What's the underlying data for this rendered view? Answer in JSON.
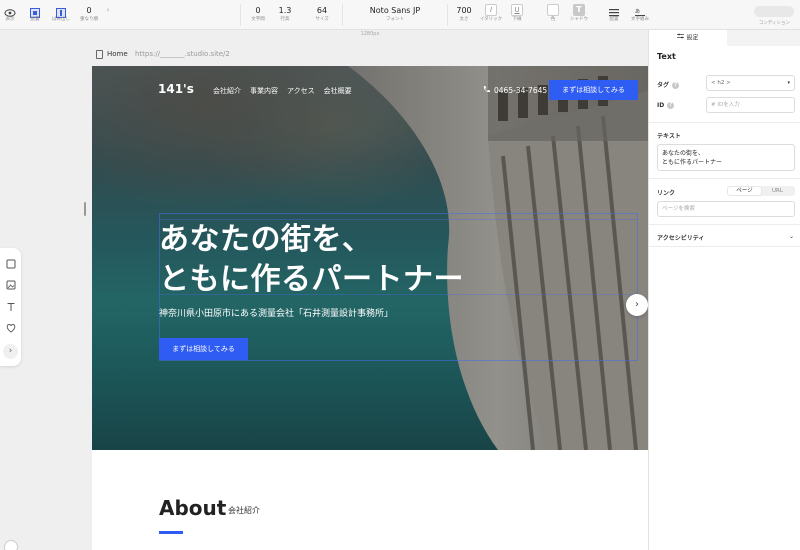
{
  "toolbar": {
    "left_tools": [
      {
        "label": "表示",
        "icon": "eye-icon"
      },
      {
        "label": "配置",
        "icon": "layout-icon"
      },
      {
        "label": "はみ出し",
        "icon": "overflow-icon"
      },
      {
        "label": "重なり順",
        "value": "0"
      }
    ],
    "text_tools": {
      "letter_spacing": {
        "label": "文字間",
        "value": "0"
      },
      "line_height": {
        "label": "行高",
        "value": "1.3"
      },
      "size": {
        "label": "サイズ",
        "value": "64"
      },
      "font": {
        "label": "フォント",
        "value": "Noto Sans JP"
      },
      "weight": {
        "label": "太さ",
        "value": "700"
      },
      "italic": {
        "label": "イタリック",
        "icon": "italic-icon"
      },
      "underline": {
        "label": "下線",
        "icon": "underline-icon"
      },
      "color": {
        "label": "色"
      },
      "shadow": {
        "label": "シャドウ",
        "icon": "text-shadow-icon"
      },
      "align": {
        "label": "配置",
        "icon": "align-icon"
      },
      "wrap": {
        "label": "文字組み",
        "icon": "text-wrap-icon"
      }
    },
    "condition_label": "コンディション"
  },
  "ruler_label": "1280px",
  "frame": {
    "home": "Home",
    "url": "https://_______.studio.site/2"
  },
  "hero": {
    "logo": "141's",
    "nav": [
      "会社紹介",
      "事業内容",
      "アクセス",
      "会社概要"
    ],
    "phone": "0465-34-7645",
    "cta_top": "まずは相談してみる",
    "headline_line1": "あなたの街を、",
    "headline_line2": "ともに作るパートナー",
    "subline": "神奈川県小田原市にある測量会社「石井測量設計事務所」",
    "cta_hero": "まずは相談してみる"
  },
  "about": {
    "title": "About",
    "subtitle": "会社紹介"
  },
  "panel": {
    "tab_settings": "設定",
    "title": "Text",
    "tag_label": "タグ",
    "tag_value": "< h2 >",
    "id_label": "ID",
    "id_placeholder": "# IDを入力",
    "text_label": "テキスト",
    "text_line1": "あなたの街を、",
    "text_line2": "ともに作るパートナー",
    "link_label": "リンク",
    "link_page": "ページ",
    "link_url": "URL",
    "link_search": "ページを検索",
    "a11y_label": "アクセシビリティ"
  },
  "colors": {
    "accent": "#2f5cf2"
  }
}
